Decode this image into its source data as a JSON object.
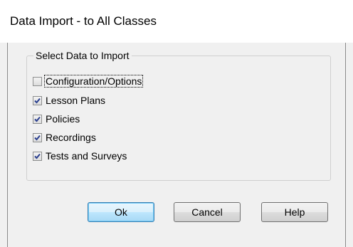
{
  "window": {
    "title": "Data Import - to All Classes"
  },
  "group": {
    "label": "Select Data to Import",
    "items": [
      {
        "label": "Configuration/Options",
        "checked": false,
        "focused": true
      },
      {
        "label": "Lesson Plans",
        "checked": true,
        "focused": false
      },
      {
        "label": "Policies",
        "checked": true,
        "focused": false
      },
      {
        "label": "Recordings",
        "checked": true,
        "focused": false
      },
      {
        "label": "Tests and Surveys",
        "checked": true,
        "focused": false
      }
    ]
  },
  "buttons": {
    "ok": "Ok",
    "cancel": "Cancel",
    "help": "Help"
  },
  "colors": {
    "check_mark": "#2a3f8f",
    "default_button_border": "#3c7fb1"
  }
}
